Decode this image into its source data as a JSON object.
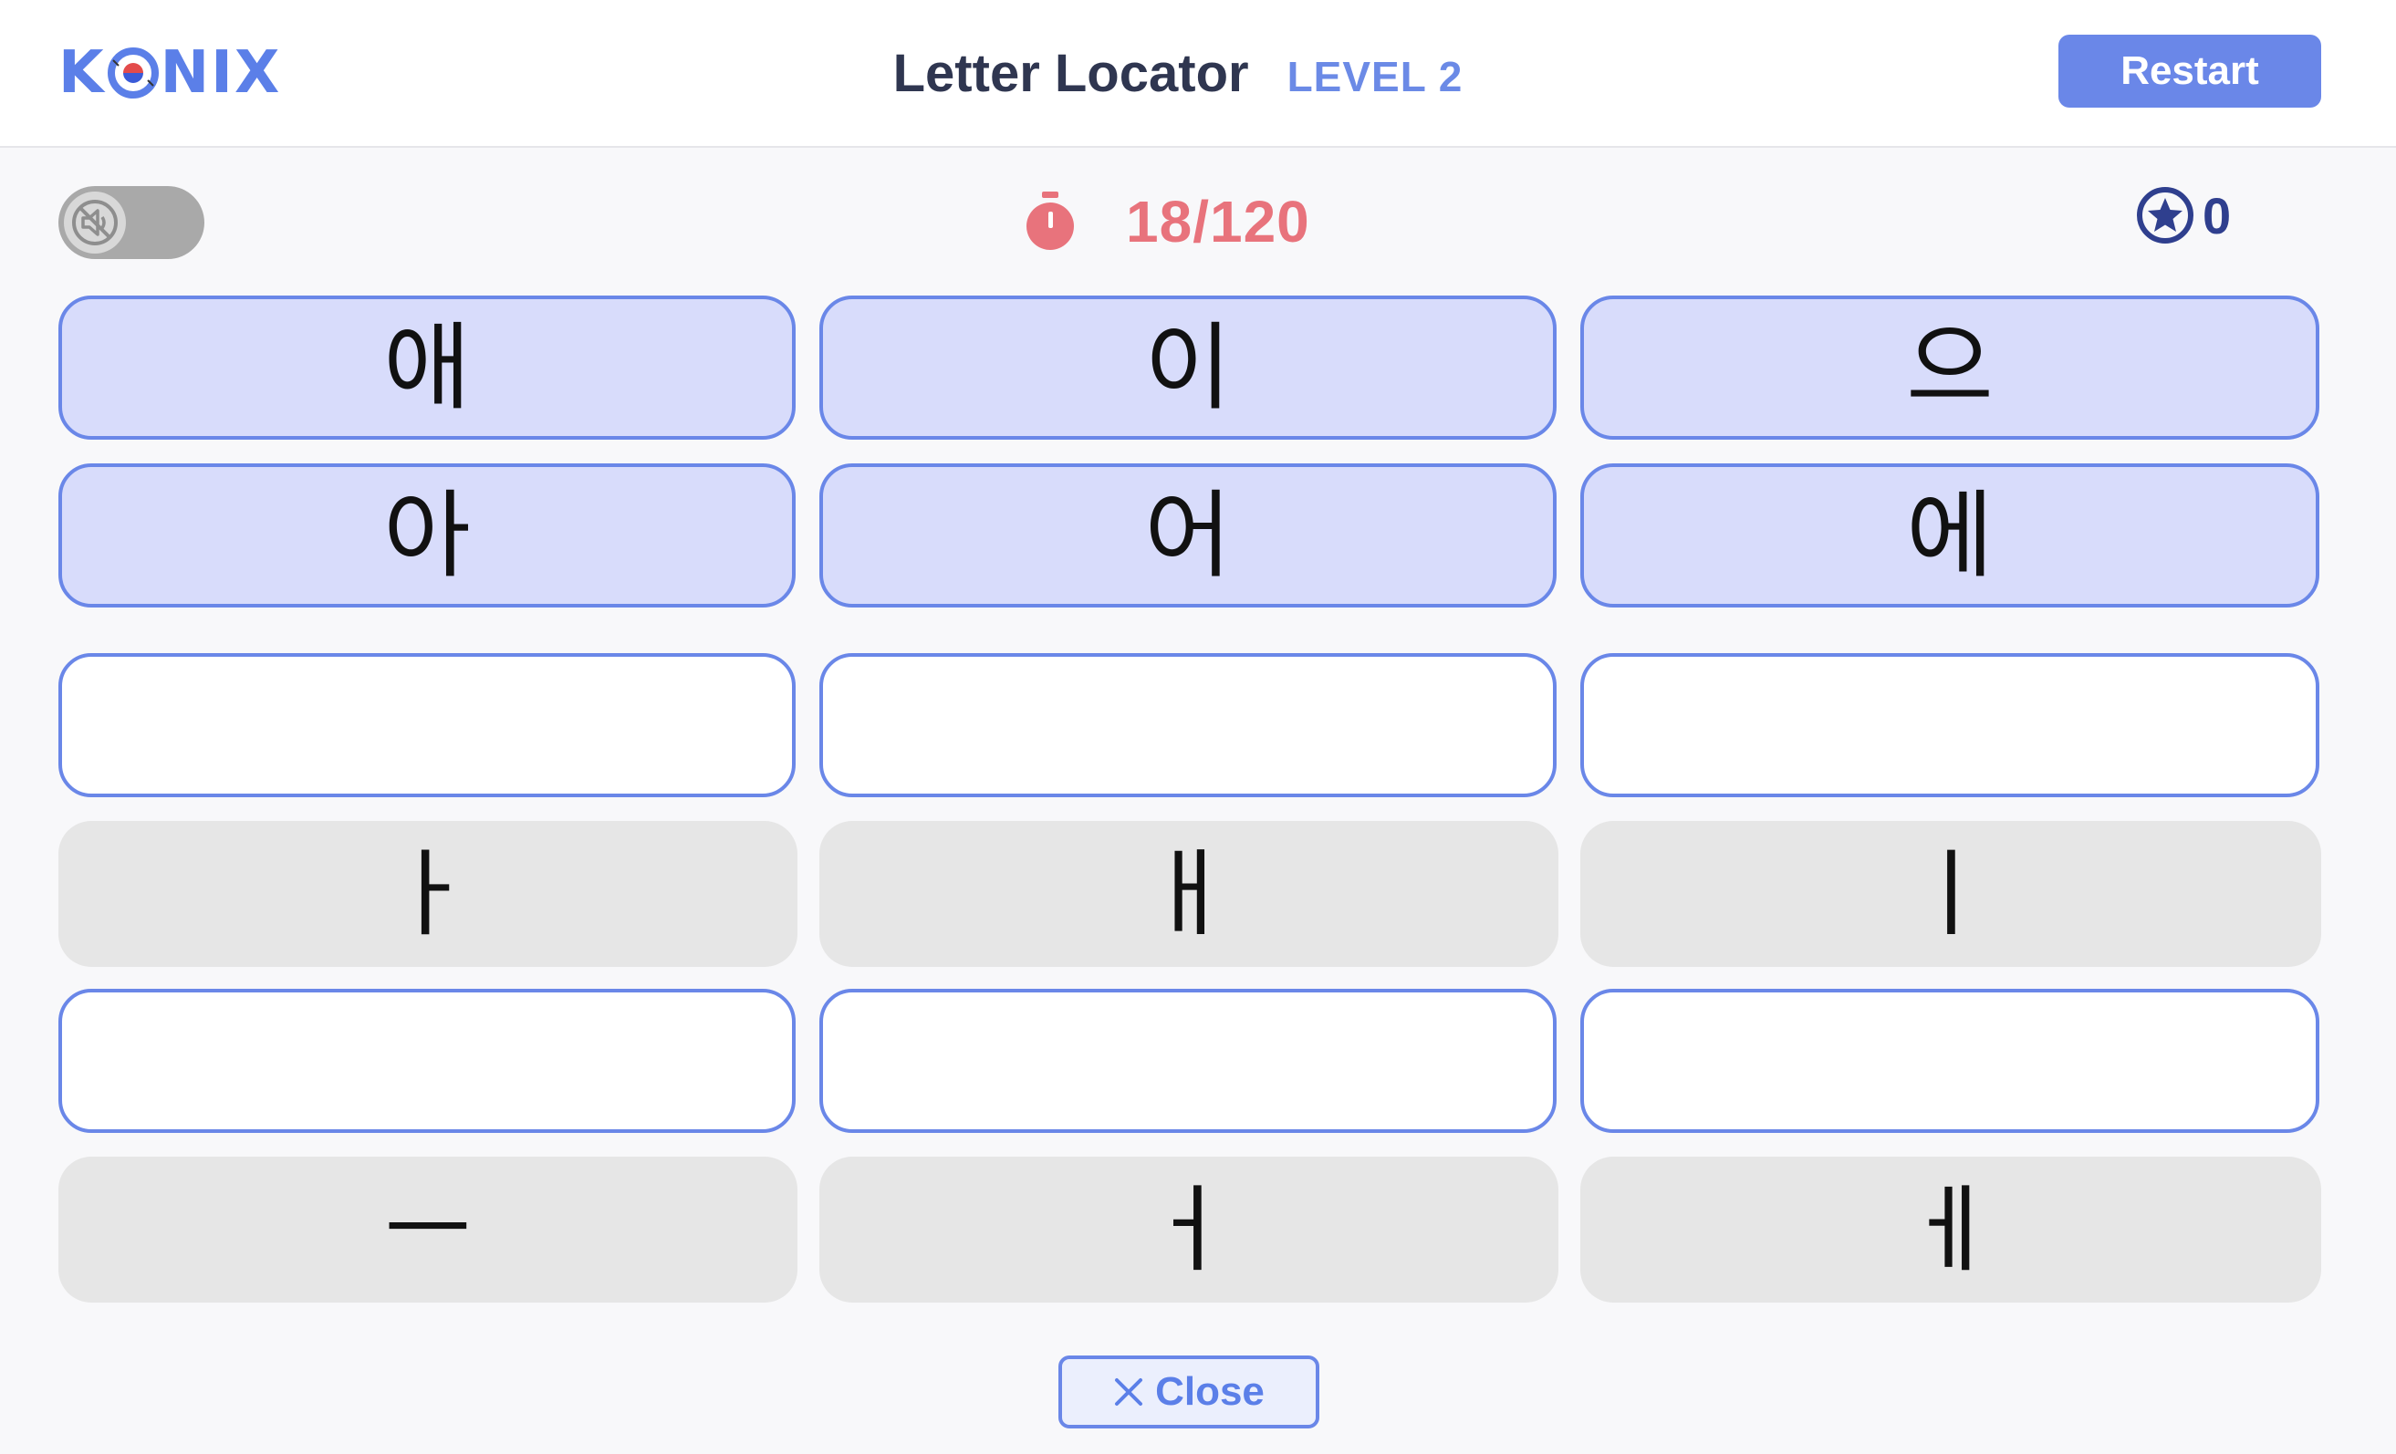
{
  "header": {
    "logo": {
      "before": "K",
      "after": "NIX"
    },
    "title": "Letter Locator",
    "level": "LEVEL 2",
    "restart_label": "Restart"
  },
  "status": {
    "sound_muted": true,
    "timer": "18/120",
    "score": "0"
  },
  "syllable_rows": [
    [
      "애",
      "이",
      "으"
    ],
    [
      "아",
      "어",
      "에"
    ]
  ],
  "answer_rows": [
    {
      "slots": [
        "",
        "",
        ""
      ]
    },
    {
      "vowels": [
        "ㅏ",
        "ㅐ",
        "ㅣ"
      ]
    },
    {
      "slots": [
        "",
        "",
        ""
      ]
    },
    {
      "vowels": [
        "ㅡ",
        "ㅓ",
        "ㅔ"
      ]
    }
  ],
  "close_label": "Close",
  "colors": {
    "accent": "#6a87e8",
    "syllable_bg": "#d8dcfb",
    "vowel_bg": "#e6e6e6",
    "timer": "#e8737c",
    "score": "#2f3f8e"
  }
}
